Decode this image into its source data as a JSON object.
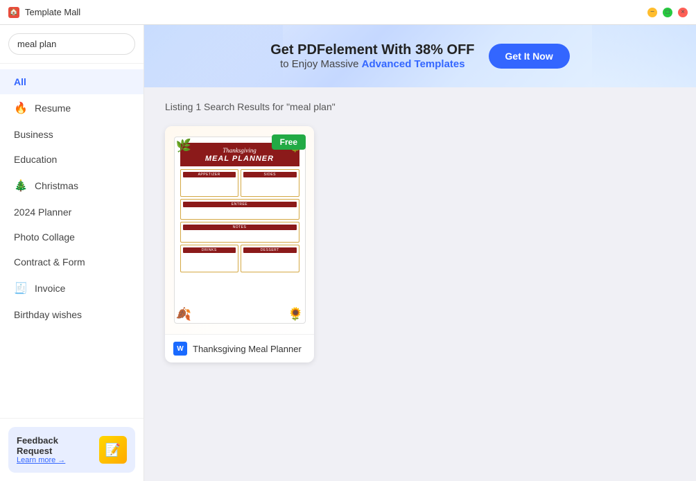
{
  "titleBar": {
    "appName": "Template Mall",
    "appIcon": "🏠"
  },
  "sidebar": {
    "searchPlaceholder": "meal plan",
    "searchValue": "meal plan",
    "allLabel": "All",
    "items": [
      {
        "id": "resume",
        "label": "Resume",
        "icon": "🔥",
        "hasIcon": true
      },
      {
        "id": "business",
        "label": "Business",
        "hasIcon": false
      },
      {
        "id": "education",
        "label": "Education",
        "hasIcon": false
      },
      {
        "id": "christmas",
        "label": "Christmas",
        "icon": "🎄",
        "hasIcon": true
      },
      {
        "id": "planner-2024",
        "label": "2024 Planner",
        "hasIcon": false
      },
      {
        "id": "photo-collage",
        "label": "Photo Collage",
        "hasIcon": false
      },
      {
        "id": "contract-form",
        "label": "Contract & Form",
        "hasIcon": false
      },
      {
        "id": "invoice",
        "label": "Invoice",
        "icon": "🧾",
        "hasIcon": true
      },
      {
        "id": "birthday-wishes",
        "label": "Birthday wishes",
        "hasIcon": false
      }
    ],
    "feedback": {
      "title": "Feedback Request",
      "linkText": "Learn more →",
      "emoji": "📝"
    }
  },
  "banner": {
    "line1": "Get PDFelement With 38% OFF",
    "line2Text": "to Enjoy Massive ",
    "line2Highlight": "Advanced Templates",
    "buttonLabel": "Get It Now"
  },
  "results": {
    "headerText": "Listing 1 Search Results for \"meal plan\"",
    "templates": [
      {
        "id": "thanksgiving-meal-planner",
        "title": "Thanksgiving Meal Planner",
        "badgeLabel": "Free",
        "typeIcon": "W",
        "sections": [
          "APPETIZER",
          "SIDES",
          "ENTREE",
          "NOTES",
          "DRINKS",
          "DESSERT"
        ],
        "headerLine1": "Thanksgiving",
        "headerLine2": "MEAL PLANNER"
      }
    ]
  }
}
